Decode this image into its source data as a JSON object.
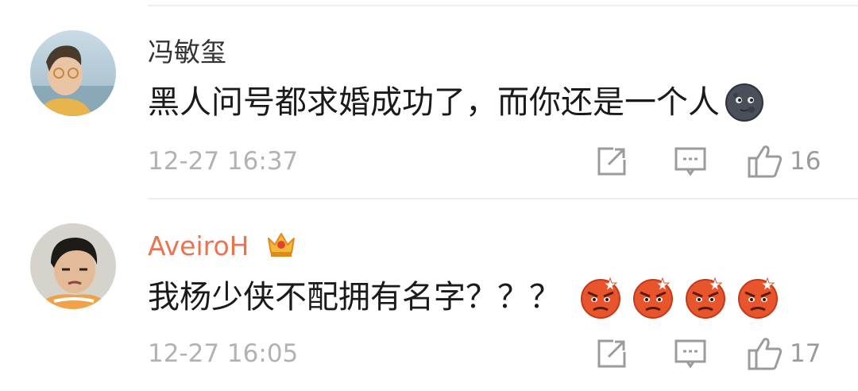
{
  "comments": [
    {
      "username": "冯敏玺",
      "username_color": "#333333",
      "text": "黑人问号都求婚成功了，而你还是一个人",
      "emoji": "new-moon-face-icon",
      "time": "12-27 16:37",
      "likes": "16"
    },
    {
      "username": "AveiroH",
      "username_color": "#eb7350",
      "badge": "crown-badge-icon",
      "text": "我杨少侠不配拥有名字？？？",
      "emoji": "angry-face-icon",
      "emoji_count": 4,
      "time": "12-27 16:05",
      "likes": "17"
    }
  ],
  "colors": {
    "meta": "#b2b2b2",
    "icon": "#9b9b9b",
    "divider": "#eeeeee"
  }
}
